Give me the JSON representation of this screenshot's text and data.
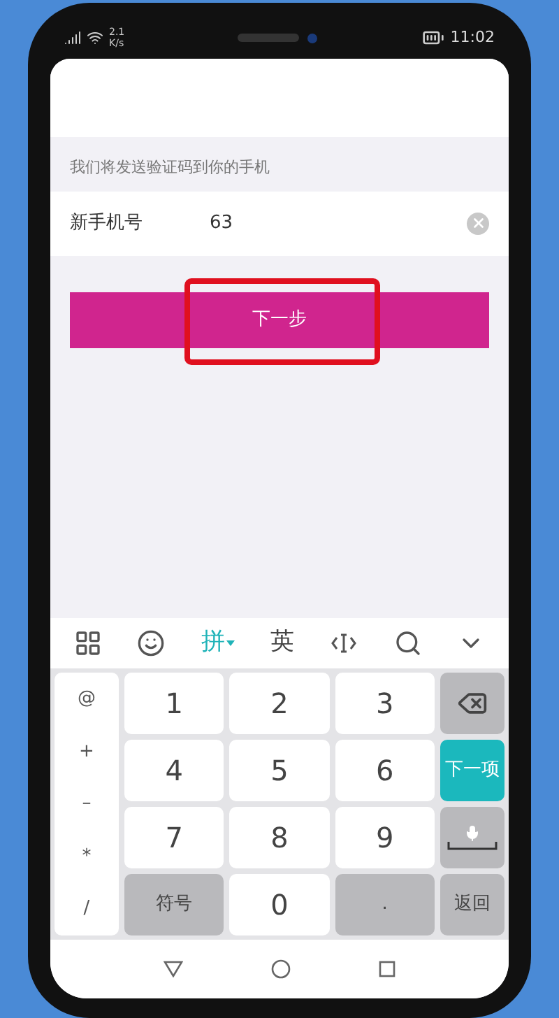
{
  "status_bar": {
    "network_speed": "2.1 K/s",
    "time": "11:02"
  },
  "hint": "我们将发送验证码到你的手机",
  "phone_field": {
    "label": "新手机号",
    "value": "63"
  },
  "next_button": {
    "label": "下一步",
    "highlighted": true
  },
  "keyboard_toolbar": [
    {
      "kind": "grid"
    },
    {
      "kind": "emoji"
    },
    {
      "kind": "text",
      "label": "拼",
      "selected": true
    },
    {
      "kind": "text",
      "label": "英",
      "selected": false
    },
    {
      "kind": "cursor"
    },
    {
      "kind": "search"
    },
    {
      "kind": "collapse"
    }
  ],
  "symbol_column": [
    "@",
    "+",
    "–",
    "*",
    "/"
  ],
  "keys": [
    {
      "kind": "digit",
      "label": "1"
    },
    {
      "kind": "digit",
      "label": "2"
    },
    {
      "kind": "digit",
      "label": "3"
    },
    {
      "kind": "digit",
      "label": "4"
    },
    {
      "kind": "digit",
      "label": "5"
    },
    {
      "kind": "digit",
      "label": "6"
    },
    {
      "kind": "digit",
      "label": "7"
    },
    {
      "kind": "digit",
      "label": "8"
    },
    {
      "kind": "digit",
      "label": "9"
    },
    {
      "kind": "function",
      "label": "符号"
    },
    {
      "kind": "digit",
      "label": "0"
    },
    {
      "kind": "function",
      "label": "."
    }
  ],
  "side_keys": [
    {
      "kind": "backspace"
    },
    {
      "kind": "action",
      "label": "下一项"
    },
    {
      "kind": "space"
    },
    {
      "kind": "function",
      "label": "返回"
    }
  ]
}
